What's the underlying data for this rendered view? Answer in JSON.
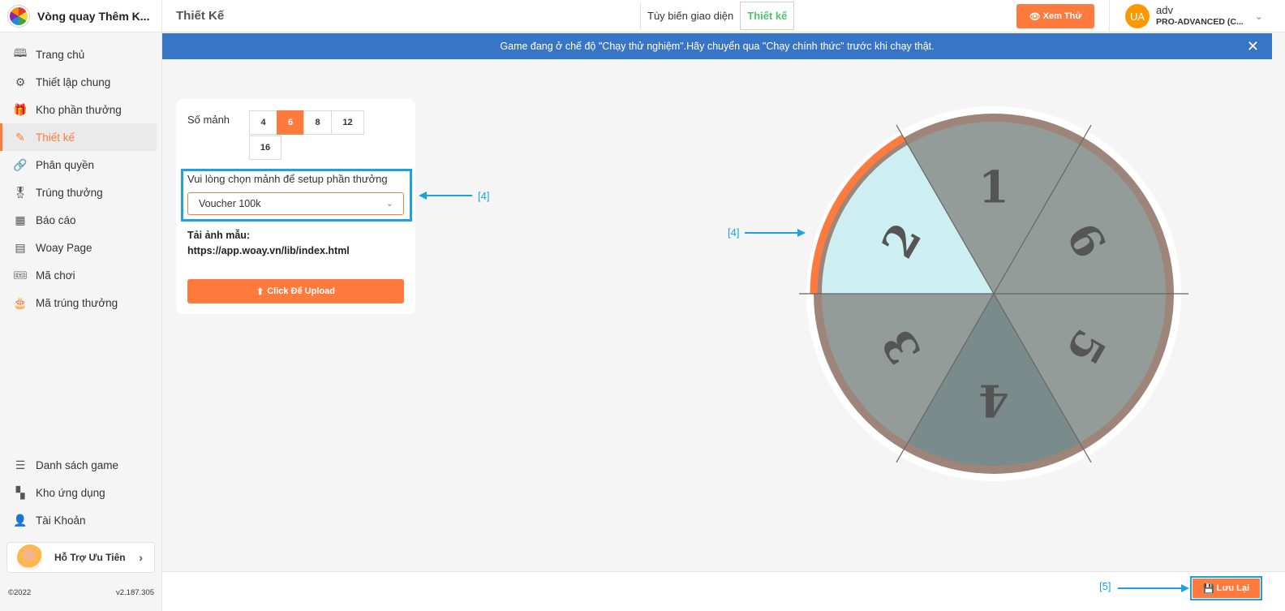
{
  "app": {
    "title": "Vòng quay Thêm K...",
    "copyright": "©2022",
    "version": "v2.187.305"
  },
  "sidebar": {
    "items": [
      {
        "label": "Trang chủ",
        "icon": "book-open-icon",
        "glyph": "🕮"
      },
      {
        "label": "Thiết lập chung",
        "icon": "gear-icon",
        "glyph": "⚙"
      },
      {
        "label": "Kho phần thưởng",
        "icon": "gift-icon",
        "glyph": "🎁"
      },
      {
        "label": "Thiết kế",
        "icon": "edit-icon",
        "glyph": "✎",
        "active": true
      },
      {
        "label": "Phân quyền",
        "icon": "link-icon",
        "glyph": "🔗"
      },
      {
        "label": "Trúng thưởng",
        "icon": "award-icon",
        "glyph": "🎖"
      },
      {
        "label": "Báo cáo",
        "icon": "grid-icon",
        "glyph": "▦"
      },
      {
        "label": "Woay Page",
        "icon": "layout-icon",
        "glyph": "▤"
      },
      {
        "label": "Mã chơi",
        "icon": "ticket-icon",
        "glyph": "🎟"
      },
      {
        "label": "Mã trúng thưởng",
        "icon": "cake-icon",
        "glyph": "🎂"
      }
    ],
    "bottom_items": [
      {
        "label": "Danh sách game",
        "icon": "menu-icon",
        "glyph": "☰"
      },
      {
        "label": "Kho ứng dụng",
        "icon": "apps-icon",
        "glyph": "▚"
      },
      {
        "label": "Tài Khoản",
        "icon": "user-icon",
        "glyph": "👤"
      }
    ],
    "support": {
      "label": "Hỗ Trợ Ưu Tiên",
      "chevron": "›"
    }
  },
  "header": {
    "page_title": "Thiết Kế",
    "tabs": [
      {
        "label": "Tùy biến giao diện",
        "active": false
      },
      {
        "label": "Thiết kế",
        "active": true
      }
    ],
    "preview_label": "Xem Thử",
    "preview_icon": "👁",
    "user": {
      "avatar": "UA",
      "name": "adv",
      "plan": "PRO-ADVANCED (C...",
      "chevron": "⌄"
    }
  },
  "banner": {
    "text": "Game đang ở chế độ \"Chạy thử nghiệm\".Hãy chuyển qua \"Chạy chính thức\" trước khi chạy thật.",
    "close": "✕"
  },
  "panel": {
    "segments_label": "Số mảnh",
    "segment_options": [
      "4",
      "6",
      "8",
      "12",
      "16"
    ],
    "segment_selected": "6",
    "select_label": "Vui lòng chọn mảnh để setup phần thưởng",
    "select_value": "Voucher 100k",
    "select_chevron": "⌄",
    "sample_title": "Tải ảnh mẫu:",
    "sample_url": "https://app.woay.vn/lib/index.html",
    "upload_label": "Click Để Upload",
    "upload_icon": "⬆"
  },
  "annotations": {
    "select_marker": "[4]",
    "wheel_marker": "[4]",
    "save_marker": "[5]"
  },
  "wheel": {
    "segments": [
      "1",
      "2",
      "3",
      "4",
      "5",
      "6"
    ],
    "selected": "2",
    "colors": {
      "segment": "#949c9a",
      "dark_segment": "#7a8b8c",
      "selected": "#cdeff2",
      "rim": "#9e857a",
      "highlight_arc": "#ff7a3d",
      "number": "#555555"
    }
  },
  "footer": {
    "save_label": "Lưu Lại",
    "save_icon": "💾"
  },
  "colors": {
    "accent": "#ff7a3d",
    "banner": "#3875c6",
    "annotation": "#1aa3e0",
    "tab_active": "#55c26a"
  }
}
